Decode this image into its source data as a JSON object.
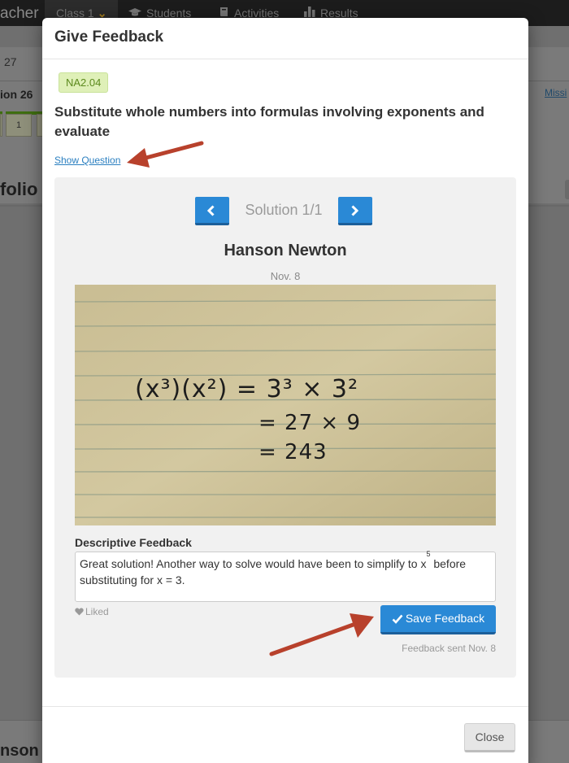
{
  "background": {
    "brand": "acher",
    "nav_tabs": [
      {
        "label": "Class 1",
        "icon": "chevron-down-icon"
      },
      {
        "label": "Students",
        "icon": "graduation-cap-icon"
      },
      {
        "label": "Activities",
        "icon": "book-icon"
      },
      {
        "label": "Results",
        "icon": "bar-chart-icon"
      }
    ],
    "subbar_text": "27",
    "mission_title": "ion 26",
    "mission_link": "Missi",
    "chip_label": "1",
    "portfolio_heading": "folio",
    "bottom_name": "nson"
  },
  "modal": {
    "title": "Give Feedback",
    "standard_code": "NA2.04",
    "standard_title": "Substitute whole numbers into formulas involving exponents and evaluate",
    "show_question_link": "Show Question",
    "solution": {
      "counter": "Solution 1/1",
      "student_name": "Hanson Newton",
      "date": "Nov. 8",
      "handwriting": [
        "(x³)(x²) = 3³ × 3²",
        "= 27 × 9",
        "= 243"
      ]
    },
    "feedback": {
      "label": "Descriptive Feedback",
      "text_before": "Great solution! Another way to solve would have been to simplify to x",
      "text_exp": "5",
      "text_after": " before substituting for x = 3.",
      "liked_label": "Liked",
      "save_label": "Save Feedback",
      "sent_label": "Feedback sent Nov. 8"
    },
    "close_label": "Close"
  },
  "colors": {
    "primary": "#2a89d6",
    "badge_bg": "#dff0b8",
    "annotation_arrow": "#b8412c"
  }
}
